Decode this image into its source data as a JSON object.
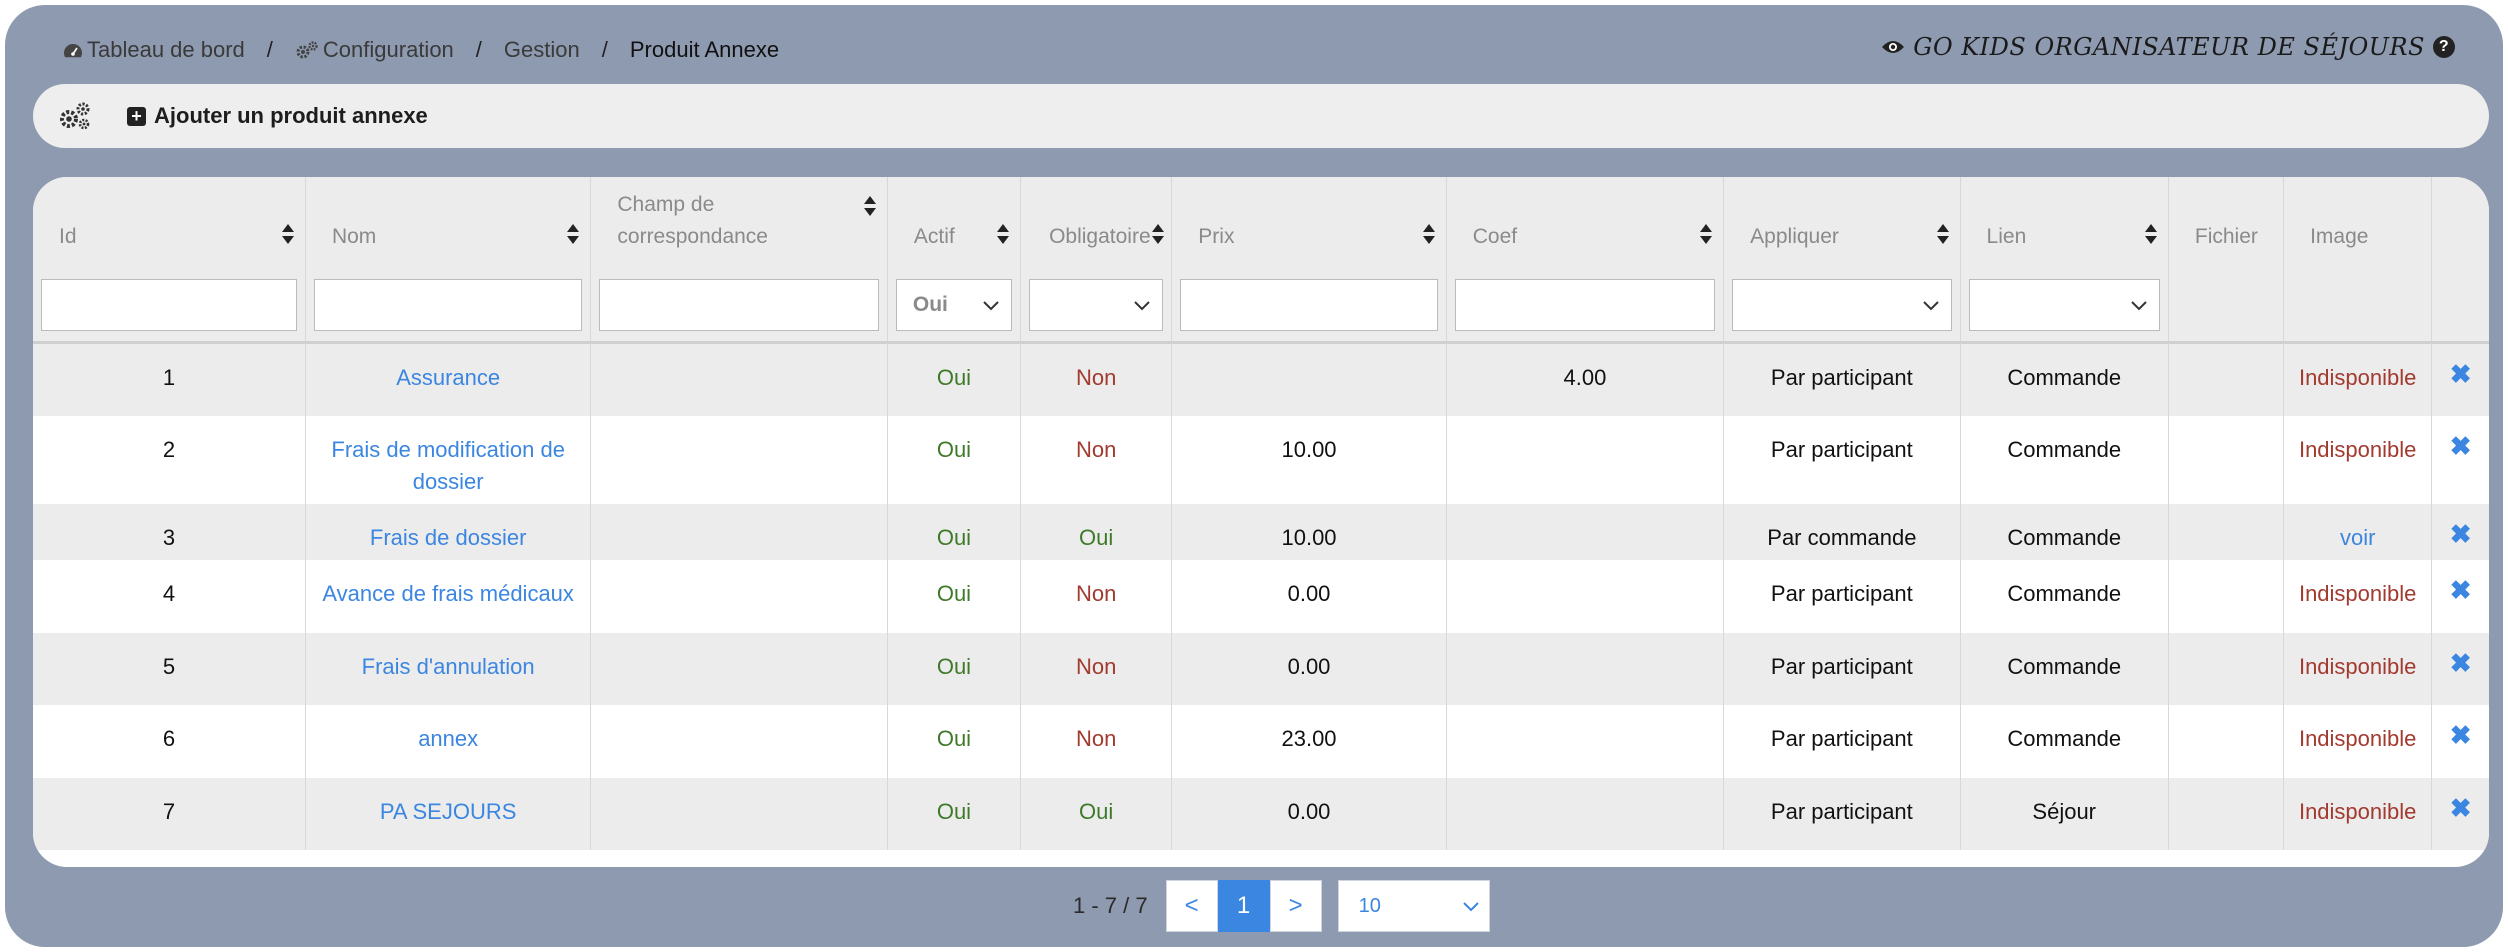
{
  "breadcrumb": {
    "items": [
      {
        "label": "Tableau de bord"
      },
      {
        "label": "Configuration"
      },
      {
        "label": "Gestion"
      },
      {
        "label": "Produit Annexe"
      }
    ],
    "separator": "/"
  },
  "brand": {
    "name": "GO KIDS ORGANISATEUR DE SÉJOURS",
    "help_label": "?"
  },
  "toolbar": {
    "add_label": "Ajouter un produit annexe"
  },
  "table": {
    "columns": [
      {
        "key": "id",
        "label": "Id"
      },
      {
        "key": "nom",
        "label": "Nom"
      },
      {
        "key": "champ",
        "label": "Champ de correspondance"
      },
      {
        "key": "actif",
        "label": "Actif"
      },
      {
        "key": "obligatoire",
        "label": "Obligatoire"
      },
      {
        "key": "prix",
        "label": "Prix"
      },
      {
        "key": "coef",
        "label": "Coef"
      },
      {
        "key": "appliquer",
        "label": "Appliquer"
      },
      {
        "key": "lien",
        "label": "Lien"
      },
      {
        "key": "fichier",
        "label": "Fichier"
      },
      {
        "key": "image",
        "label": "Image"
      }
    ],
    "filters": {
      "actif_value": "Oui"
    },
    "rows": [
      {
        "id": "1",
        "nom": "Assurance",
        "champ": "",
        "actif": "Oui",
        "obligatoire": "Non",
        "prix": "",
        "coef": "4.00",
        "appliquer": "Par participant",
        "lien": "Commande",
        "fichier": "",
        "image": "Indisponible"
      },
      {
        "id": "2",
        "nom": "Frais de modification de dossier",
        "champ": "",
        "actif": "Oui",
        "obligatoire": "Non",
        "prix": "10.00",
        "coef": "",
        "appliquer": "Par participant",
        "lien": "Commande",
        "fichier": "",
        "image": "Indisponible"
      },
      {
        "id": "3",
        "nom": "Frais de dossier",
        "champ": "",
        "actif": "Oui",
        "obligatoire": "Oui",
        "prix": "10.00",
        "coef": "",
        "appliquer": "Par commande",
        "lien": "Commande",
        "fichier": "",
        "image": "voir"
      },
      {
        "id": "4",
        "nom": "Avance de frais médicaux",
        "champ": "",
        "actif": "Oui",
        "obligatoire": "Non",
        "prix": "0.00",
        "coef": "",
        "appliquer": "Par participant",
        "lien": "Commande",
        "fichier": "",
        "image": "Indisponible"
      },
      {
        "id": "5",
        "nom": "Frais d'annulation",
        "champ": "",
        "actif": "Oui",
        "obligatoire": "Non",
        "prix": "0.00",
        "coef": "",
        "appliquer": "Par participant",
        "lien": "Commande",
        "fichier": "",
        "image": "Indisponible"
      },
      {
        "id": "6",
        "nom": "annex",
        "champ": "",
        "actif": "Oui",
        "obligatoire": "Non",
        "prix": "23.00",
        "coef": "",
        "appliquer": "Par participant",
        "lien": "Commande",
        "fichier": "",
        "image": "Indisponible"
      },
      {
        "id": "7",
        "nom": "PA SEJOURS",
        "champ": "",
        "actif": "Oui",
        "obligatoire": "Oui",
        "prix": "0.00",
        "coef": "",
        "appliquer": "Par participant",
        "lien": "Séjour",
        "fichier": "",
        "image": "Indisponible"
      }
    ]
  },
  "pagination": {
    "info": "1 - 7 / 7",
    "prev": "<",
    "current": "1",
    "next": ">",
    "page_size": "10"
  },
  "colors": {
    "background": "#8e9ab0",
    "link": "#3b86e0",
    "oui": "#3f7a2b",
    "non": "#a23a2f"
  },
  "icons": [
    "dashboard-icon",
    "gears-icon",
    "eye-icon",
    "help-icon",
    "plus-square-icon",
    "sort-icon",
    "chevron-down-icon",
    "delete-icon"
  ]
}
